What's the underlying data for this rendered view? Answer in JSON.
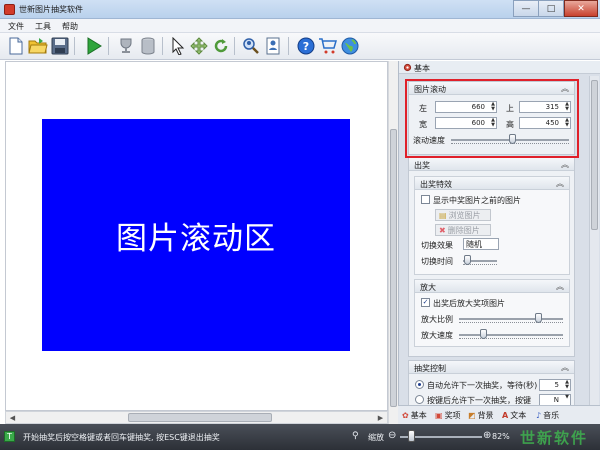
{
  "window": {
    "title": "世新图片抽奖软件",
    "minimize_symbol": "—",
    "maximize_symbol": "□",
    "close_symbol": "✕"
  },
  "menu": {
    "items": [
      "文件",
      "工具",
      "帮助"
    ]
  },
  "toolbar": {
    "icons": [
      "new-document-icon",
      "open-folder-icon",
      "save-icon",
      "play-icon",
      "trophy-icon",
      "database-icon",
      "pointer-icon",
      "move-icon",
      "rotate-icon",
      "zoom-user-icon",
      "user-list-icon",
      "help-icon",
      "cart-icon",
      "globe-icon"
    ]
  },
  "canvas": {
    "board_text": "图片滚动区",
    "board_color": "#0000ff"
  },
  "panel": {
    "header": "基本",
    "scroll_group": {
      "title": "图片滚动",
      "left_label": "左",
      "left_value": "660",
      "top_label": "上",
      "top_value": "315",
      "width_label": "宽",
      "width_value": "600",
      "height_label": "高",
      "height_value": "450",
      "speed_label": "滚动速度",
      "speed_level": 0.52
    },
    "prize_group": {
      "title": "出奖",
      "effect_group": {
        "title": "出奖特效",
        "show_before_label": "显示中奖图片之前的图片",
        "show_before_checked": false,
        "browse_button": "浏览图片",
        "delete_button": "删除图片",
        "switch_effect_label": "切换效果",
        "switch_effect_value": "随机",
        "switch_time_label": "切换时间",
        "switch_time_level": 0.05
      },
      "zoom_group": {
        "title": "放大",
        "enlarge_label": "出奖后放大奖项图片",
        "enlarge_checked": true,
        "ratio_label": "放大比例",
        "ratio_level": 0.78,
        "speed_label": "放大速度",
        "speed_level": 0.22
      }
    },
    "draw_control": {
      "title": "抽奖控制",
      "auto_label": "自动允许下一次抽奖，等待(秒)",
      "auto_selected": true,
      "auto_value": "5",
      "key_label": "按键后允许下一次抽奖，按键",
      "key_selected": false,
      "key_value": "N"
    },
    "tabs": [
      "基本",
      "奖项",
      "背景",
      "文本",
      "音乐"
    ]
  },
  "status": {
    "text": "开始抽奖后按空格键或者回车键抽奖, 按ESC键退出抽奖",
    "zoom_label": "缩放",
    "zoom_value": "82%",
    "zoom_level": 0.1,
    "watermark": "世新软件"
  },
  "colors": {
    "highlight_border": "#e0202a",
    "status_bar": "#2c3037"
  }
}
